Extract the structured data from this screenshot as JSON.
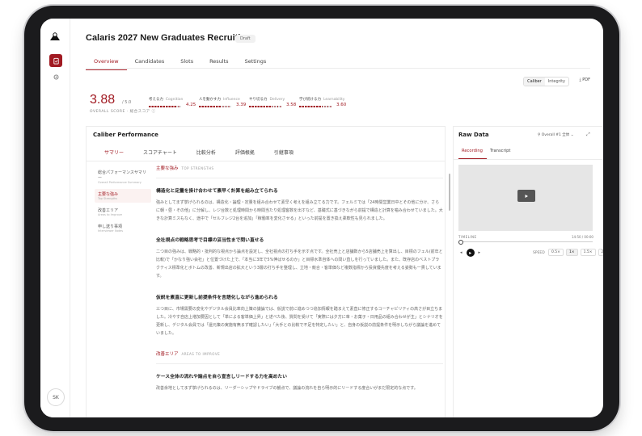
{
  "app": {
    "title": "Calaris 2027 New Graduates Recruiting",
    "status_badge": "Draft",
    "user_initials": "SK"
  },
  "main_tabs": [
    "Overview",
    "Candidates",
    "Slots",
    "Results",
    "Settings"
  ],
  "view_toggle": {
    "options": [
      "Caliber",
      "Integrity"
    ],
    "pdf_label": "PDF"
  },
  "overall": {
    "score": "3.88",
    "max": "/ 5.0",
    "label": "OVERALL SCORE · 総合スコア"
  },
  "metrics": [
    {
      "jp": "考える力",
      "en": "Cognition",
      "value": "4.25",
      "fraction": 0.85
    },
    {
      "jp": "人を動かす力",
      "en": "Influence",
      "value": "3.39",
      "fraction": 0.68
    },
    {
      "jp": "やり切る力",
      "en": "Delivery",
      "value": "3.58",
      "fraction": 0.72
    },
    {
      "jp": "学び続ける力",
      "en": "Learnability",
      "value": "3.60",
      "fraction": 0.72
    }
  ],
  "caliber": {
    "title": "Caliber Performance",
    "subtabs": [
      "サマリー",
      "スコアチャート",
      "比較分析",
      "評価根拠",
      "引継事項"
    ],
    "nav": [
      {
        "jp": "総合パフォーマンスサマリー",
        "en": "Overall Performance Summary"
      },
      {
        "jp": "主要な強み",
        "en": "Top Strengths"
      },
      {
        "jp": "改善エリア",
        "en": "Areas to Improve"
      },
      {
        "jp": "申し送り事項",
        "en": "Interviewer Notes"
      }
    ],
    "strengths_label": "主要な強み",
    "strengths_en": "TOP STRENGTHS",
    "strengths": [
      {
        "heading": "構造化と定量を掛け合わせて素早く計算を組み立てられる",
        "body": "強みとしてまず挙げられるのは、構造化・論理・定量を組み合わせて素早く考えを組み立てる力です。フェルミでは「24時間営業日中とその他に分け、さらに朝・昼・その他」に分解し、レジ台数と処理時間から時間当たり処理客数を出すなど、基礎式に基づきながら前提で構造と計算を噛み合わせていました。大きな計算ミスもなく、途中で「セルフレジ2台を追加」「稼働率を変化させる」といった前提を置き換え柔軟性も見られました。"
      },
      {
        "heading": "全社視点の戦略思考で目標の妥当性まで問い直せる",
        "body": "二つ目の強みは、戦略的・批判的な視点から論点を設定し、全社視点の打ち手を示す点です。全社売上と店舗数から5店舗売上を算出し、目標のフェル(前年と比較)で「かなり強い会社」と位置づけた上で、「本当に3年で5%伸ばせるのか」と目標水準自体への問い直しを行っていました。また、既存店のベストプラクティス標準化とボトムの改善、新規出店の拡大という3層の打ち手を整理し、立地・競合・客単価など複数指標から投資優先度を考える姿勢も一貫しています。"
      },
      {
        "heading": "仮説を素直に更新し前提条件を言語化しながら進められる",
        "body": "三つ目に、市場需要の変化やデジタル会員比率向上策の議論では、仮説で前に進めつつ追加情報を踏まえて素直に修正するコーチャビリティの高さが目立ちました。冷やす自店上増加要因として「単による客単価上昇」と述べた後、質問を受けて「実際には夕方に傘・お菓子・日用品の組み合わせが主」とシナリオを更新し、デジタル会員では「還元策の実施有無まず確認したい」「大手との比較で不足を特定したい」と、自身の仮説の前提条件を明示しながら議論を進めていました。"
      }
    ],
    "improve_label": "改善エリア",
    "improve_en": "AREAS TO IMPROVE",
    "improvements": [
      {
        "heading": "ケース全体の流れや論点を自ら宣言しリードする力を高めたい",
        "body": "改善余地としてまず挙げられるのは、リーダーシップやドライブの観点で、議論の流れを自ら明示的にリードする度合いがまだ限定的な点です。"
      }
    ]
  },
  "raw_data": {
    "title": "Raw Data",
    "filter_label": "Overall #1 全体",
    "tabs": [
      "Recording",
      "Transcript"
    ],
    "timeline_label": "TIMELINE",
    "timeline_time": "14:50 / 00:00",
    "speed_label": "SPEED",
    "speeds": [
      "0.5×",
      "1×",
      "1.5×",
      "2×"
    ]
  }
}
